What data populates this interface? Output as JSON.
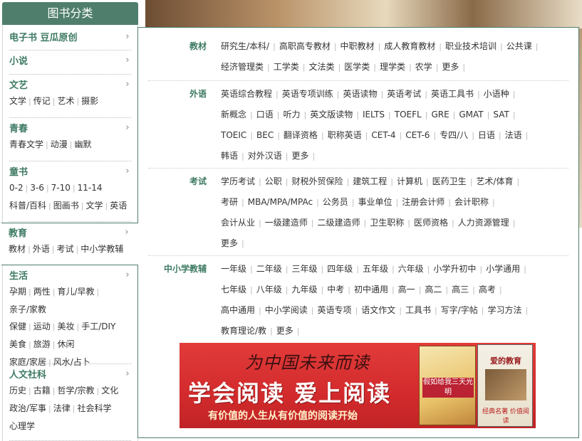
{
  "sidebar": {
    "title": "图书分类",
    "categories": [
      {
        "title": "电子书 豆瓜原创",
        "items": []
      },
      {
        "title": "小说",
        "items": []
      },
      {
        "title": "文艺",
        "items": [
          "文学",
          "传记",
          "艺术",
          "摄影"
        ]
      },
      {
        "title": "青春",
        "items": [
          "青春文学",
          "动漫",
          "幽默"
        ]
      },
      {
        "title": "童书",
        "items": [
          "0-2",
          "3-6",
          "7-10",
          "11-14",
          "科普/百科",
          "图画书",
          "文学",
          "英语"
        ]
      },
      {
        "title": "教育",
        "items": [
          "教材",
          "外语",
          "考试",
          "中小学教辅"
        ]
      },
      {
        "title": "生活",
        "items": [
          "孕期",
          "两性",
          "育儿/早教",
          "亲子/家教",
          "保健",
          "运动",
          "美妆",
          "手工/DIY",
          "美食",
          "旅游",
          "休闲",
          "家庭/家居",
          "风水/占卜"
        ]
      },
      {
        "title": "人文社科",
        "items": [
          "历史",
          "古籍",
          "哲学/宗教",
          "文化",
          "政治/军事",
          "法律",
          "社会科学",
          "心理学"
        ]
      }
    ]
  },
  "flyout": {
    "groups": [
      {
        "title": "教材",
        "links": [
          "研究生/本科/",
          "高职高专教材",
          "中职教材",
          "成人教育教材",
          "职业技术培训",
          "公共课",
          "经济管理类",
          "工学类",
          "文法类",
          "医学类",
          "理学类",
          "农学",
          "更多"
        ]
      },
      {
        "title": "外语",
        "links": [
          "英语综合教程",
          "英语专项训练",
          "英语读物",
          "英语考试",
          "英语工具书",
          "小语种",
          "新概念",
          "口语",
          "听力",
          "英文版读物",
          "IELTS",
          "TOEFL",
          "GRE",
          "GMAT",
          "SAT",
          "TOEIC",
          "BEC",
          "翻译资格",
          "职称英语",
          "CET-4",
          "CET-6",
          "专四/八",
          "日语",
          "法语",
          "韩语",
          "对外汉语",
          "更多"
        ]
      },
      {
        "title": "考试",
        "links": [
          "学历考试",
          "公职",
          "财税外贸保险",
          "建筑工程",
          "计算机",
          "医药卫生",
          "艺术/体育",
          "考研",
          "MBA/MPA/MPAc",
          "公务员",
          "事业单位",
          "注册会计师",
          "会计职称",
          "会计从业",
          "一级建造师",
          "二级建造师",
          "卫生职称",
          "医师资格",
          "人力资源管理",
          "更多"
        ]
      },
      {
        "title": "中小学教辅",
        "links": [
          "一年级",
          "二年级",
          "三年级",
          "四年级",
          "五年级",
          "六年级",
          "小学升初中",
          "小学通用",
          "七年级",
          "八年级",
          "九年级",
          "中考",
          "初中通用",
          "高一",
          "高二",
          "高三",
          "高考",
          "高中通用",
          "中小学阅读",
          "英语专项",
          "语文作文",
          "工具书",
          "写字/字帖",
          "学习方法",
          "教育理论/教",
          "更多"
        ]
      }
    ]
  },
  "ad": {
    "script_text": "为中国未来而读",
    "headline": "学会阅读 爱上阅读",
    "subline": "有价值的人生从有价值的阅读开始",
    "book1_title": "假如给我三天光明",
    "book2_title": "爱的教育",
    "book2_sub": "经典名著 价值阅读"
  },
  "colors": {
    "accent": "#4f7f6c",
    "category_text": "#3d7a62",
    "ad_red": "#d32b2d"
  }
}
